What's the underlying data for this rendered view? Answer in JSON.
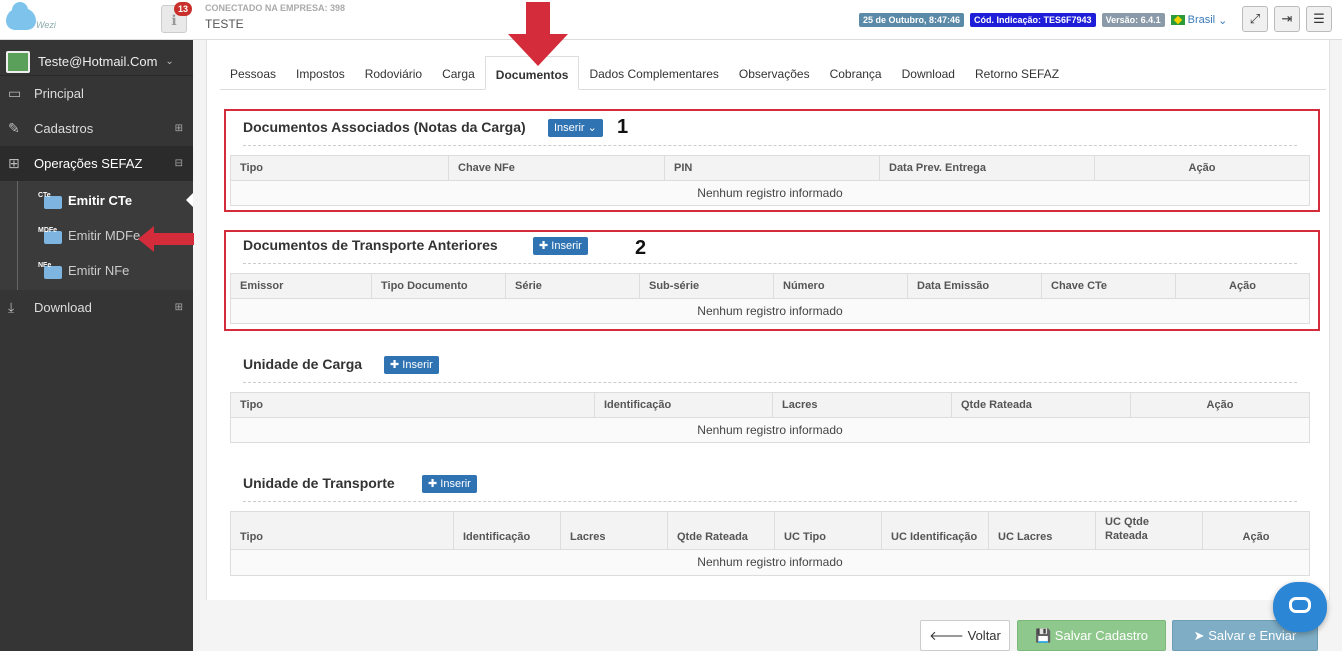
{
  "app": {
    "logo_text": "Wezi"
  },
  "header": {
    "notifications": "13",
    "company_label": "CONECTADO NA EMPRESA: 398",
    "company_name": "TESTE",
    "date": "25 de Outubro, 8:47:46",
    "indicacao": "Cód. Indicação: TES6F7943",
    "version": "Versão: 6.4.1",
    "language": "Brasil"
  },
  "sidebar": {
    "user": "Teste@Hotmail.Com",
    "items": [
      {
        "label": "Principal"
      },
      {
        "label": "Cadastros"
      },
      {
        "label": "Operações SEFAZ"
      },
      {
        "label": "Download"
      }
    ],
    "sub": [
      {
        "label": "Emitir CTe",
        "badge": "CTe"
      },
      {
        "label": "Emitir MDFe",
        "badge": "MDFe"
      },
      {
        "label": "Emitir NFe",
        "badge": "NFe"
      }
    ]
  },
  "tabs": [
    "Pessoas",
    "Impostos",
    "Rodoviário",
    "Carga",
    "Documentos",
    "Dados Complementares",
    "Observações",
    "Cobrança",
    "Download",
    "Retorno SEFAZ"
  ],
  "sections": {
    "docs_assoc": {
      "title": "Documentos Associados (Notas da Carga)",
      "button": "Inserir",
      "columns": [
        "Tipo",
        "Chave NFe",
        "PIN",
        "Data Prev. Entrega",
        "Ação"
      ],
      "empty": "Nenhum registro informado",
      "marker": "1"
    },
    "docs_transp": {
      "title": "Documentos de Transporte Anteriores",
      "button": "Inserir",
      "columns": [
        "Emissor",
        "Tipo Documento",
        "Série",
        "Sub-série",
        "Número",
        "Data Emissão",
        "Chave CTe",
        "Ação"
      ],
      "empty": "Nenhum registro informado",
      "marker": "2"
    },
    "un_carga": {
      "title": "Unidade de Carga",
      "button": "Inserir",
      "columns": [
        "Tipo",
        "Identificação",
        "Lacres",
        "Qtde Rateada",
        "Ação"
      ],
      "empty": "Nenhum registro informado"
    },
    "un_transp": {
      "title": "Unidade de Transporte",
      "button": "Inserir",
      "columns": [
        "Tipo",
        "Identificação",
        "Lacres",
        "Qtde Rateada",
        "UC Tipo",
        "UC Identificação",
        "UC Lacres",
        "UC Qtde Rateada",
        "Ação"
      ],
      "empty": "Nenhum registro informado"
    }
  },
  "footer": {
    "back": "Voltar",
    "save": "Salvar Cadastro",
    "send": "Salvar e Enviar"
  },
  "colors": {
    "annotation_red": "#d42c3a",
    "primary": "#2f73b3",
    "success": "#8fc88c"
  }
}
